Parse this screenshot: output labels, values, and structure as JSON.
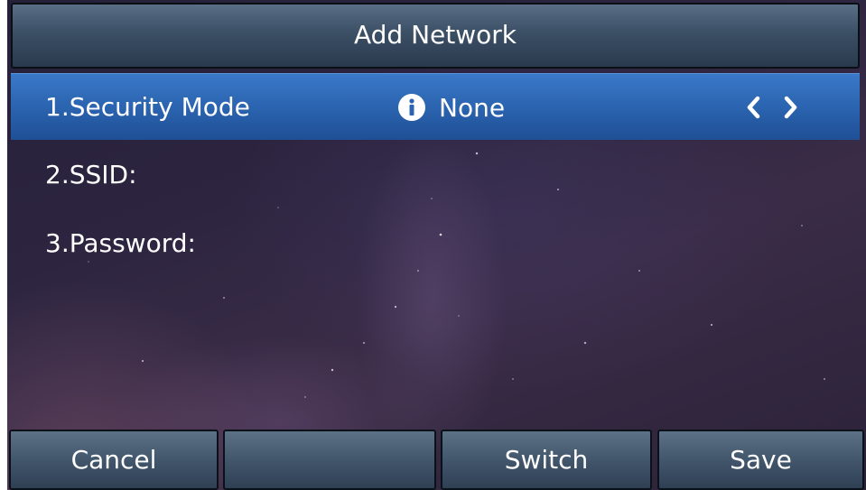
{
  "header": {
    "title": "Add Network"
  },
  "fields": [
    {
      "label": "1.Security Mode",
      "value": "None",
      "icon": "info-icon",
      "selected": true
    },
    {
      "label": "2.SSID:",
      "value": ""
    },
    {
      "label": "3.Password:",
      "value": ""
    }
  ],
  "softkeys": [
    {
      "label": "Cancel"
    },
    {
      "label": ""
    },
    {
      "label": "Switch"
    },
    {
      "label": "Save"
    }
  ],
  "colors": {
    "selection": "#2b64b0",
    "bar": "#3b4f65",
    "text": "#ffffff"
  }
}
